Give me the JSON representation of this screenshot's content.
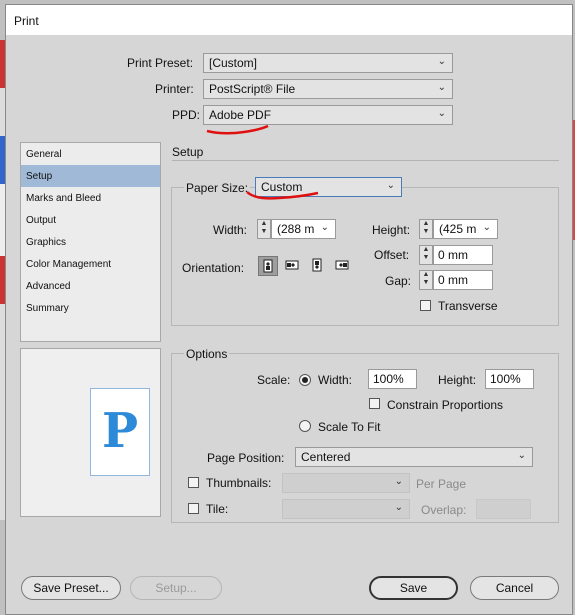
{
  "window": {
    "title": "Print"
  },
  "top": {
    "print_preset_label": "Print Preset:",
    "print_preset_value": "[Custom]",
    "printer_label": "Printer:",
    "printer_value": "PostScript® File",
    "ppd_label": "PPD:",
    "ppd_value": "Adobe PDF"
  },
  "sidebar": {
    "items": [
      {
        "label": "General"
      },
      {
        "label": "Setup",
        "active": true
      },
      {
        "label": "Marks and Bleed"
      },
      {
        "label": "Output"
      },
      {
        "label": "Graphics"
      },
      {
        "label": "Color Management"
      },
      {
        "label": "Advanced"
      },
      {
        "label": "Summary"
      }
    ]
  },
  "preview": {
    "letter": "P"
  },
  "setup": {
    "heading": "Setup",
    "paper_size_label": "Paper Size:",
    "paper_size_value": "Custom",
    "width_label": "Width:",
    "width_value": "(288 m",
    "height_label": "Height:",
    "height_value": "(425 m",
    "offset_label": "Offset:",
    "offset_value": "0 mm",
    "gap_label": "Gap:",
    "gap_value": "0 mm",
    "orientation_label": "Orientation:",
    "transverse_label": "Transverse"
  },
  "options": {
    "heading": "Options",
    "scale_label": "Scale:",
    "width_label": "Width:",
    "width_value": "100%",
    "height_label": "Height:",
    "height_value": "100%",
    "constrain_label": "Constrain Proportions",
    "scale_to_fit_label": "Scale To Fit",
    "page_position_label": "Page Position:",
    "page_position_value": "Centered",
    "thumbnails_label": "Thumbnails:",
    "per_page_label": "Per Page",
    "tile_label": "Tile:",
    "overlap_label": "Overlap:"
  },
  "buttons": {
    "save_preset": "Save Preset...",
    "setup": "Setup...",
    "save": "Save",
    "cancel": "Cancel"
  },
  "colors": {
    "annotation_red": "#e01010",
    "selection_blue": "#9fb9d6",
    "preview_letter": "#2d8ad8"
  }
}
